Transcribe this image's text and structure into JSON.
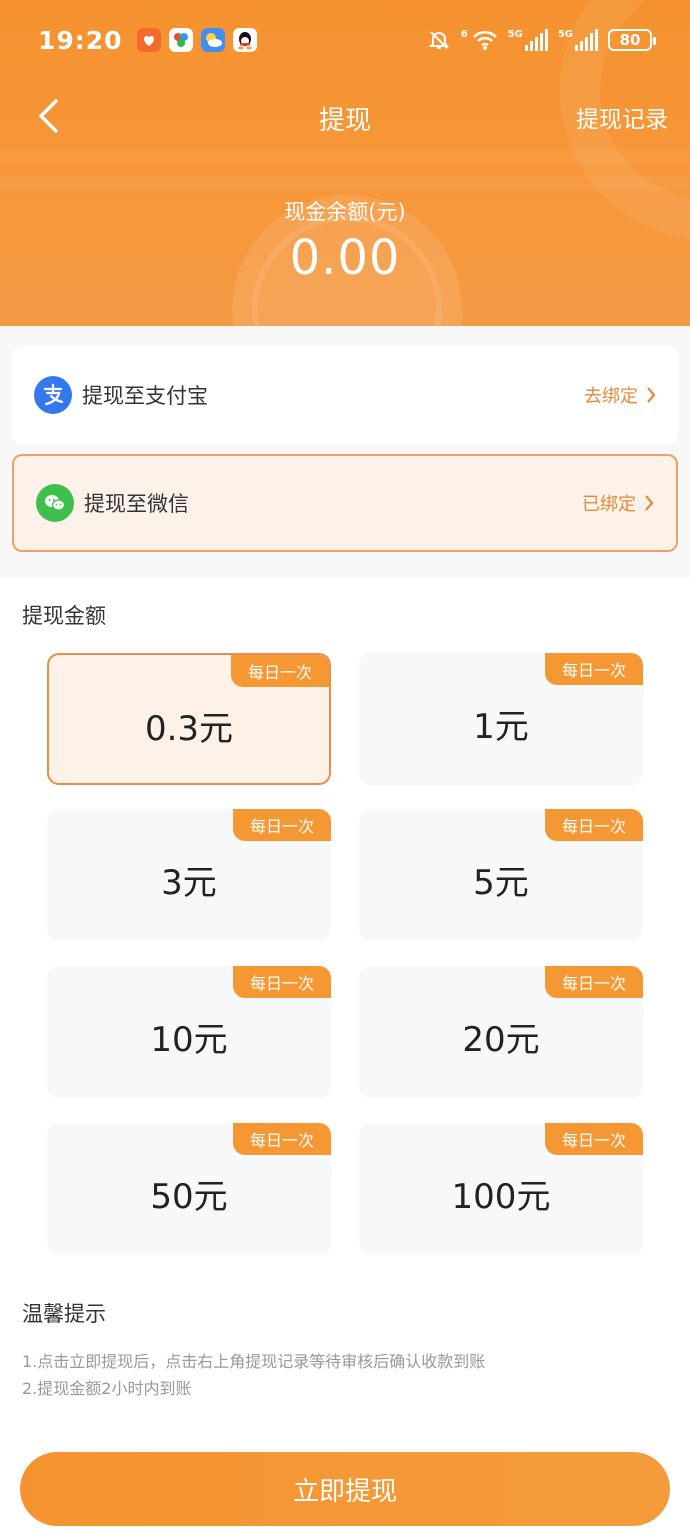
{
  "status_bar": {
    "time": "19:20",
    "network_1": "6",
    "network_2": "5G",
    "network_3": "5G",
    "battery": "80",
    "icons": [
      "weibo-app-icon",
      "photos-app-icon",
      "weather-app-icon",
      "qq-app-icon",
      "bell-muted-icon",
      "wifi-icon",
      "signal-icon",
      "battery-icon"
    ]
  },
  "nav": {
    "title": "提现",
    "record_link": "提现记录"
  },
  "balance": {
    "label": "现金余额(元)",
    "value": "0.00"
  },
  "methods": [
    {
      "label": "提现至支付宝",
      "status": "去绑定",
      "icon": "alipay-icon",
      "selected": false
    },
    {
      "label": "提现至微信",
      "status": "已绑定",
      "icon": "wechat-icon",
      "selected": true
    }
  ],
  "amount_section": {
    "title": "提现金额",
    "options": [
      {
        "amount": "0.3元",
        "badge": "每日一次",
        "selected": true
      },
      {
        "amount": "1元",
        "badge": "每日一次",
        "selected": false
      },
      {
        "amount": "3元",
        "badge": "每日一次",
        "selected": false
      },
      {
        "amount": "5元",
        "badge": "每日一次",
        "selected": false
      },
      {
        "amount": "10元",
        "badge": "每日一次",
        "selected": false
      },
      {
        "amount": "20元",
        "badge": "每日一次",
        "selected": false
      },
      {
        "amount": "50元",
        "badge": "每日一次",
        "selected": false
      },
      {
        "amount": "100元",
        "badge": "每日一次",
        "selected": false
      }
    ]
  },
  "tips": {
    "title": "温馨提示",
    "lines": [
      "1.点击立即提现后，点击右上角提现记录等待审核后确认收款到账",
      "2.提现金额2小时内到账"
    ]
  },
  "submit_label": "立即提现",
  "colors": {
    "accent": "#f5942f",
    "selected_border": "#e88e4c",
    "selected_bg": "#fdf1e8",
    "link": "#e58a3a"
  }
}
